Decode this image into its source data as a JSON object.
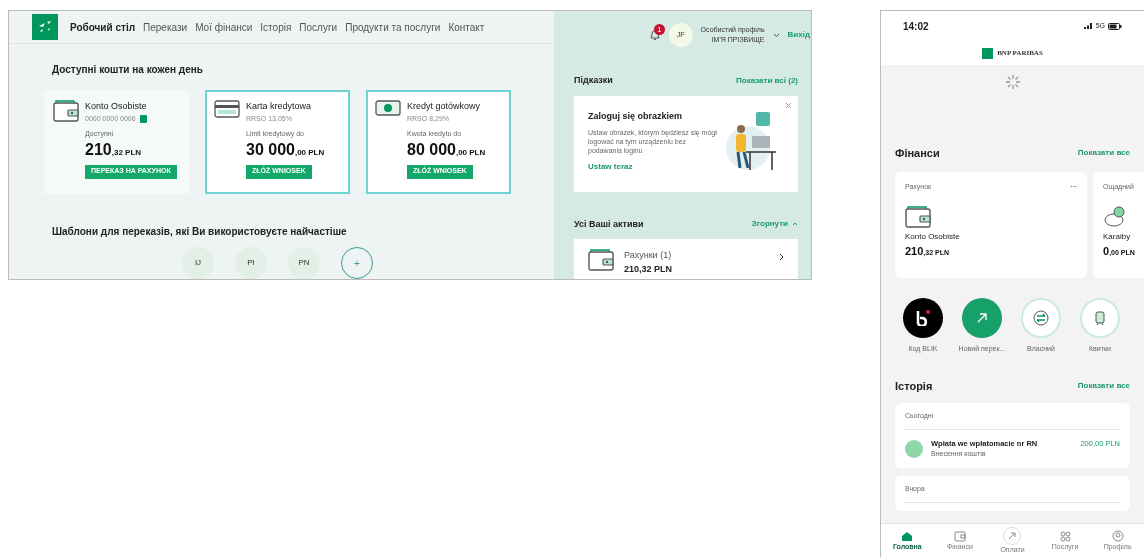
{
  "desktop": {
    "nav": [
      {
        "label": "Робочий стіл",
        "selected": true
      },
      {
        "label": "Перекази",
        "selected": false
      },
      {
        "label": "Мої фінанси",
        "selected": false
      },
      {
        "label": "Історія",
        "selected": false
      },
      {
        "label": "Послуги",
        "selected": false
      },
      {
        "label": "Продукти та послуги",
        "selected": false
      },
      {
        "label": "Контакт",
        "selected": false
      }
    ],
    "notifications_badge": "1",
    "avatar": "JF",
    "profile_label": "Особистий профіль",
    "profile_name": "ІМ'Я ПРІЗВИЩЕ",
    "logout": "Вихід",
    "funds_title": "Доступні кошти на кожен день",
    "products": [
      {
        "kind": "wallet",
        "highlighted": false,
        "name": "Konto Osobiste",
        "sub": "0000 0000 0006",
        "copyable": true,
        "amount_label": "Доступні",
        "amount": "210",
        "amount_suffix": ",32 PLN",
        "button": "ПЕРЕКАЗ НА РАХУНОК"
      },
      {
        "kind": "card",
        "highlighted": true,
        "name": "Karta kredytowa",
        "sub": "RRSO 13,05%",
        "copyable": false,
        "amount_label": "Limit kredytowy do",
        "amount": "30 000",
        "amount_suffix": ",00 PLN",
        "button": "ZŁÓŻ WNIOSEK"
      },
      {
        "kind": "cash",
        "highlighted": true,
        "name": "Kredyt gotówkowy",
        "sub": "RRSO 8,29%",
        "copyable": false,
        "amount_label": "Kwota kredytu do",
        "amount": "80 000",
        "amount_suffix": ",00 PLN",
        "button": "ZŁÓŻ WNIOSEK"
      }
    ],
    "templates_title": "Шаблони для переказів, які Ви використовуєте найчастіше",
    "templates": [
      {
        "kind": "contact",
        "label": "IJ"
      },
      {
        "kind": "contact",
        "label": "PI"
      },
      {
        "kind": "contact",
        "label": "PN"
      },
      {
        "kind": "add",
        "label": "+"
      }
    ],
    "tips_title": "Підказки",
    "tips_link": "Показати всі (2)",
    "tip": {
      "title": "Zaloguj się obrazkiem",
      "body": "Ustaw obrazek, którym będziesz się mógł logować na tym urządzeniu bez podawania loginu",
      "link": "Ustaw teraz"
    },
    "assets_title": "Усі Ваші активи",
    "assets_toggle": "Згорнути",
    "assets_expanded": true,
    "assets": [
      {
        "name": "Рахунки (1)",
        "amount": "210,32 PLN"
      }
    ]
  },
  "mobile": {
    "time": "14:02",
    "network": "5G",
    "logo": "BNP PARIBAS",
    "finance_title": "Фінанси",
    "finance_link": "Показати все",
    "accounts": [
      {
        "kind": "wallet",
        "type": "Рахунок",
        "menu": "...",
        "name": "Konto Osobiste",
        "amount": "210",
        "amount_suffix": ",32 PLN"
      },
      {
        "kind": "piggy",
        "type": "Ощадний",
        "name": "Karaiby",
        "amount": "0",
        "amount_suffix": ",00 PLN"
      }
    ],
    "actions": [
      {
        "kind": "blik",
        "label": "Код BLIK"
      },
      {
        "kind": "transfer",
        "label": "Новий перек..."
      },
      {
        "kind": "own",
        "label": "Власний"
      },
      {
        "kind": "tickets",
        "label": "Квитки"
      }
    ],
    "history_title": "Історія",
    "history_link": "Показати все",
    "history": [
      {
        "day": "Сьогодні",
        "items": [
          {
            "title": "Wpłata we wpłatomacie nr RN",
            "category": "Внесення коштів",
            "amount": "200,00 PLN"
          }
        ]
      },
      {
        "day": "Вчора"
      }
    ],
    "tabbar": [
      {
        "kind": "home",
        "label": "Головна",
        "selected": true
      },
      {
        "kind": "finance",
        "label": "Фінанси",
        "selected": false
      },
      {
        "kind": "pay",
        "label": "Оплати",
        "selected": false
      },
      {
        "kind": "services",
        "label": "Послуги",
        "selected": false
      },
      {
        "kind": "profile",
        "label": "Профіль",
        "selected": false
      }
    ]
  }
}
